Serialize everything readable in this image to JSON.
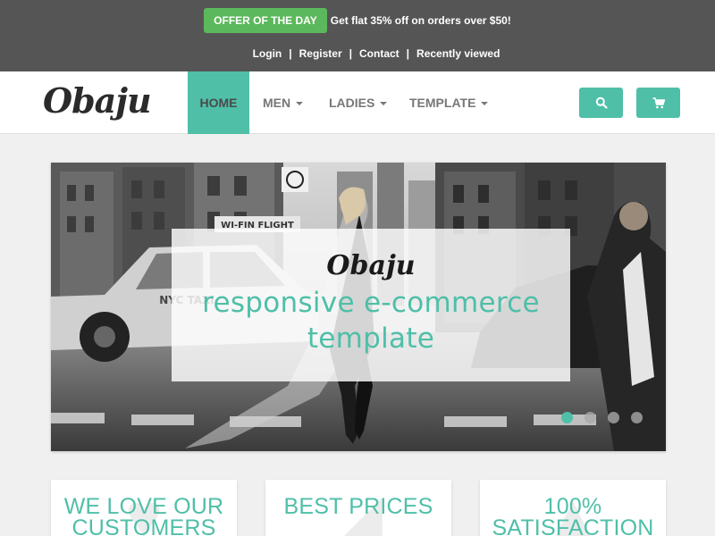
{
  "topbar": {
    "offer_label": "OFFER OF THE DAY",
    "offer_text": "Get flat 35% off on orders over $50!",
    "links": {
      "login": "Login",
      "register": "Register",
      "contact": "Contact",
      "recently_viewed": "Recently viewed"
    },
    "separator": "|"
  },
  "navbar": {
    "brand": "Obaju",
    "items": [
      {
        "label": "HOME",
        "active": true
      },
      {
        "label": "MEN",
        "dropdown": true
      },
      {
        "label": "LADIES",
        "dropdown": true
      },
      {
        "label": "TEMPLATE",
        "dropdown": true
      }
    ],
    "search_icon": "search-icon",
    "cart_icon": "cart-icon"
  },
  "hero": {
    "brand": "Obaju",
    "tagline_line1": "responsive e-commerce",
    "tagline_line2": "template",
    "slides_count": 4,
    "active_slide": 1,
    "sign_text": "WI-FIN FLIGHT",
    "taxi_text": "NYC TAXI"
  },
  "features": [
    {
      "line1": "WE LOVE OUR",
      "line2": "CUSTOMERS",
      "icon": "heart-icon"
    },
    {
      "line1": "BEST PRICES",
      "line2": "",
      "icon": "tag-icon"
    },
    {
      "line1": "100%",
      "line2": "SATISFACTION",
      "icon": "thumbs-up-icon"
    }
  ],
  "colors": {
    "accent": "#4fbfa8",
    "topbar": "#555555",
    "offer": "#5cb85c"
  }
}
